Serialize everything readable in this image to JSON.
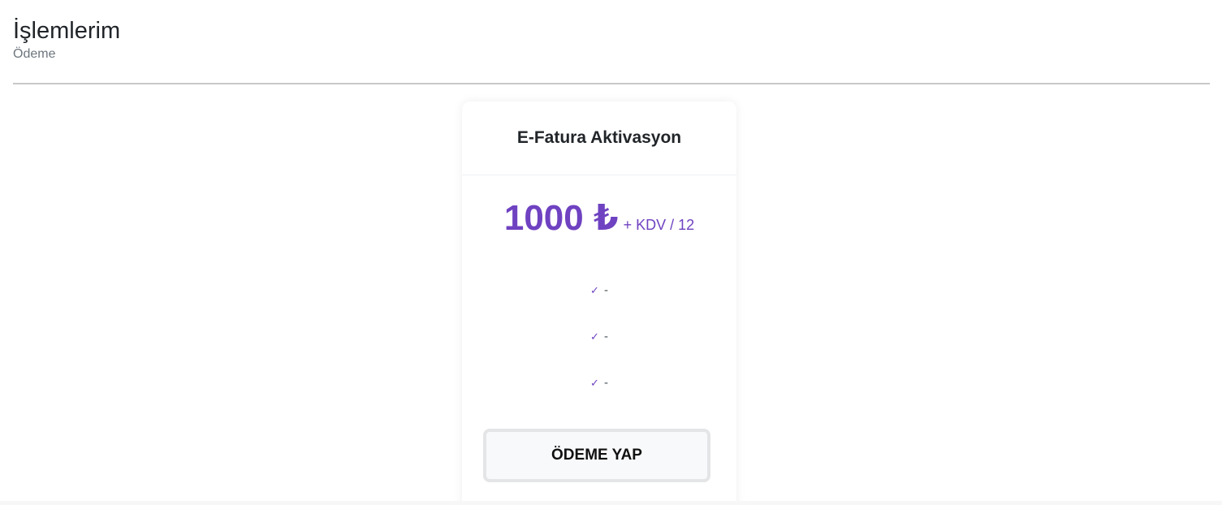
{
  "header": {
    "title": "İşlemlerim",
    "subtitle": "Ödeme"
  },
  "card": {
    "title": "E-Fatura Aktivasyon",
    "price": "1000 ₺",
    "price_suffix": "+ KDV / 12",
    "features": [
      {
        "icon": "check-icon",
        "text": "-"
      },
      {
        "icon": "check-icon",
        "text": "-"
      },
      {
        "icon": "check-icon",
        "text": "-"
      }
    ],
    "button_label": "ÖDEME YAP"
  },
  "colors": {
    "accent": "#6f42c1",
    "text": "#212529",
    "muted": "#6c757d"
  }
}
